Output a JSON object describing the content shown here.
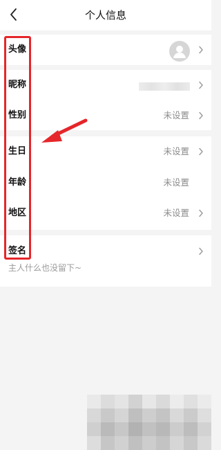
{
  "header": {
    "title": "个人信息",
    "back_icon": "chevron-left-icon"
  },
  "profile": {
    "avatar": {
      "label": "头像"
    },
    "nickname": {
      "label": "昵称"
    },
    "gender": {
      "label": "性别",
      "value": "未设置"
    },
    "birthday": {
      "label": "生日",
      "value": "未设置"
    },
    "age": {
      "label": "年龄",
      "value": "未设置"
    },
    "region": {
      "label": "地区",
      "value": "未设置"
    },
    "signature": {
      "label": "签名",
      "value": "主人什么也没留下~"
    }
  },
  "colors": {
    "annotation": "#e5262a",
    "background": "#f4f4f4",
    "row_background": "#ffffff",
    "value_text": "#8c8c8c"
  }
}
